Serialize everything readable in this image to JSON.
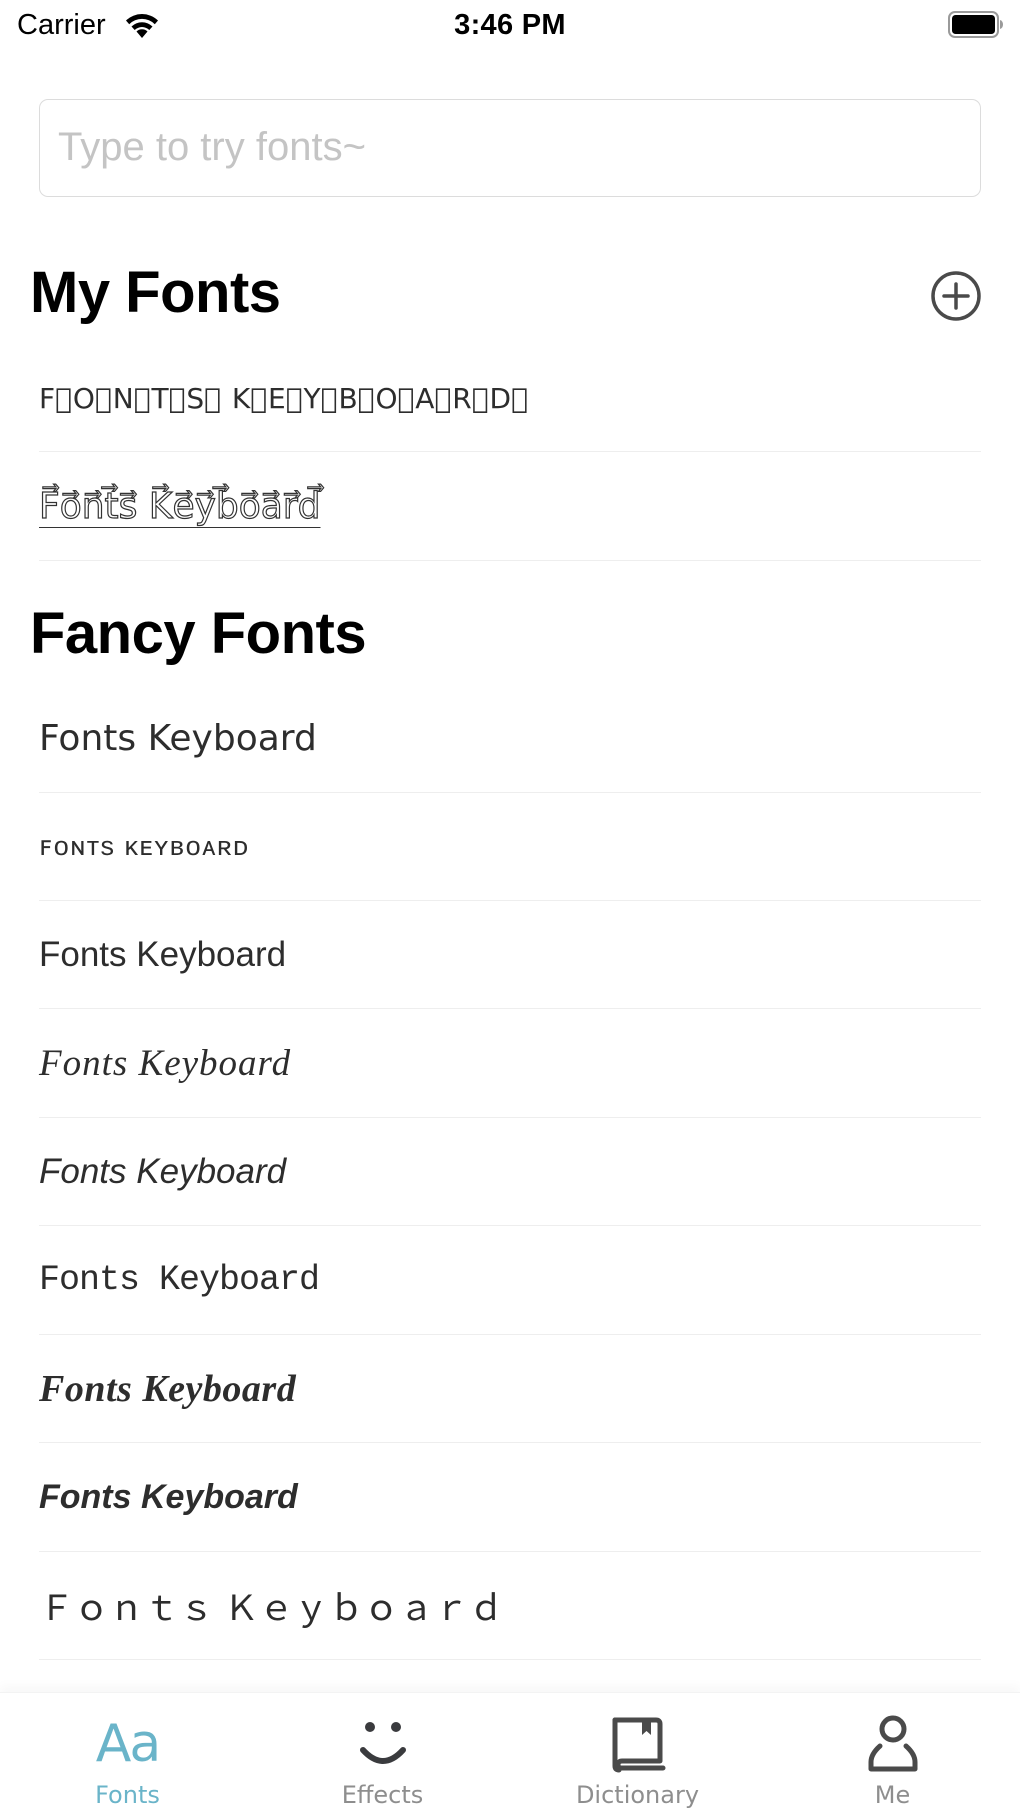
{
  "status_bar": {
    "carrier": "Carrier",
    "time": "3:46 PM",
    "wifi_icon": "wifi-icon",
    "battery_icon": "battery-icon"
  },
  "search": {
    "placeholder": "Type to try fonts~",
    "value": ""
  },
  "my_fonts": {
    "title": "My Fonts",
    "add_icon": "plus-circle-icon",
    "items": [
      {
        "label": "F⃣O⃣N⃣T⃣S⃣ K⃣E⃣Y⃣B⃣O⃣A⃣R⃣D⃣",
        "style": "keycap"
      },
      {
        "label": "F⃗o⃗n⃗t⃗s⃗ K⃗e⃗y⃗b⃗o⃗a⃗r⃗d⃗",
        "style": "outline-arrow"
      }
    ]
  },
  "fancy_fonts": {
    "title": "Fancy Fonts",
    "items": [
      {
        "label": "Fonts Keyboard",
        "style": "sans"
      },
      {
        "label": "ꜰᴏɴᴛs ᴋᴇʏʙᴏᴀʀᴅ",
        "style": "small-caps"
      },
      {
        "label": "Fonts Keyboard",
        "style": "light-sans"
      },
      {
        "label": "Fonts Keyboard",
        "style": "serif-italic"
      },
      {
        "label": "Fonts Keyboard",
        "style": "sans-italic"
      },
      {
        "label": "Fonts Keyboard",
        "style": "monospace"
      },
      {
        "label": "Fonts Keyboard",
        "style": "serif-bold-italic"
      },
      {
        "label": "Fonts Keyboard",
        "style": "sans-bold-italic"
      },
      {
        "label": "Ｆｏｎｔｓ Ｋｅｙｂｏａｒｄ",
        "style": "fullwidth"
      }
    ]
  },
  "tab_bar": {
    "accent_color": "#6ab4c9",
    "inactive_color": "#8e8e8e",
    "tabs": [
      {
        "label": "Fonts",
        "icon": "aa-icon",
        "icon_text": "Aa",
        "active": true
      },
      {
        "label": "Effects",
        "icon": "smiley-icon",
        "active": false
      },
      {
        "label": "Dictionary",
        "icon": "book-icon",
        "active": false
      },
      {
        "label": "Me",
        "icon": "person-icon",
        "active": false
      }
    ]
  }
}
